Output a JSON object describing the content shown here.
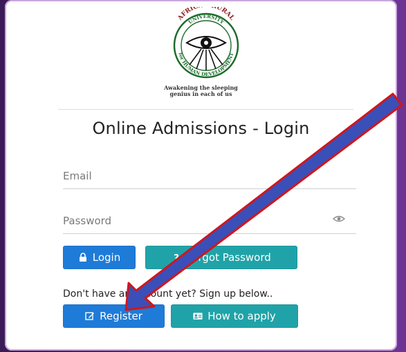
{
  "logo": {
    "arc_top": "AFRICAN RURAL",
    "arc_mid": "UNIVERSITY",
    "arc_bottom": "for HUMAN DEVELOPMENT",
    "motto_line1": "Awakening the sleeping",
    "motto_line2": "genius in each of us"
  },
  "page": {
    "title": "Online Admissions - Login"
  },
  "form": {
    "email_placeholder": "Email",
    "password_placeholder": "Password"
  },
  "buttons": {
    "login_label": "Login",
    "forgot_label": "Forgot Password",
    "register_label": "Register",
    "howto_label": "How to apply"
  },
  "signup": {
    "text": "Don't have an account yet? Sign up below.."
  },
  "colors": {
    "background": "#5b2a80",
    "primary_button": "#1f7bd8",
    "secondary_button": "#20a3a8",
    "arrow_outline": "#d0161c",
    "arrow_fill": "#3b4fb8"
  },
  "icons": {
    "login": "lock-icon",
    "forgot": "question-icon",
    "register": "edit-icon",
    "howto": "id-card-icon",
    "password_toggle": "eye-icon"
  }
}
